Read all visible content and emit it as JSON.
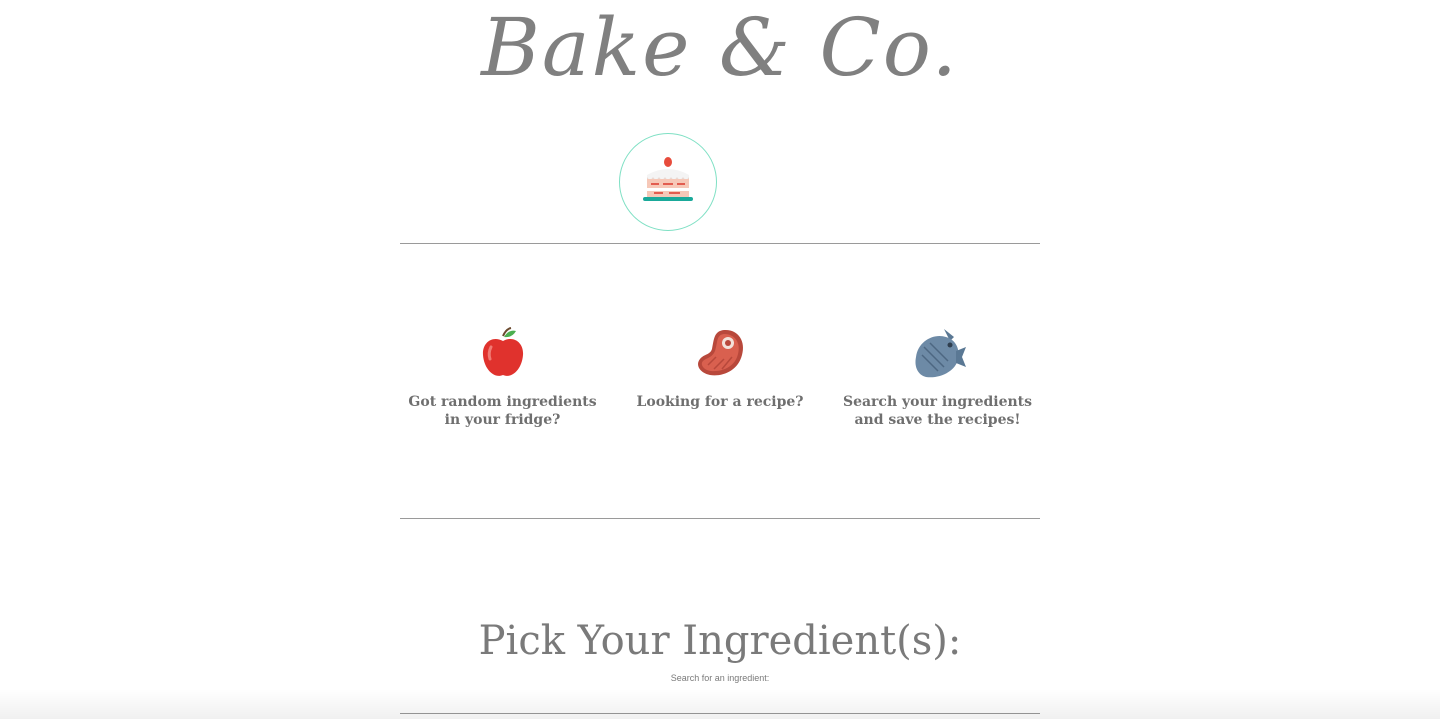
{
  "header": {
    "brand_title": "Bake & Co.",
    "logo_icon": "cake-icon"
  },
  "features": [
    {
      "icon": "apple-icon",
      "text": "Got random ingredients in your fridge?"
    },
    {
      "icon": "steak-icon",
      "text": "Looking for a recipe?"
    },
    {
      "icon": "fish-icon",
      "text": "Search your ingredients and save the recipes!"
    }
  ],
  "search": {
    "title": "Pick Your Ingredient(s):",
    "label": "Search for an ingredient:"
  },
  "colors": {
    "accent_circle": "#7fe0c4",
    "text": "#7a7a7a",
    "rule": "#9a9a9a"
  }
}
